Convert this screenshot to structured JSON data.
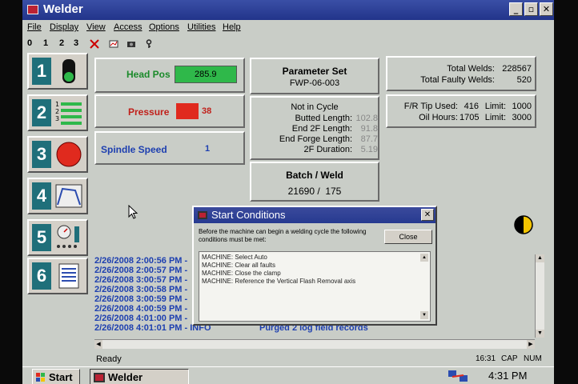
{
  "window": {
    "title": "Welder"
  },
  "menu": [
    "File",
    "Display",
    "View",
    "Access",
    "Options",
    "Utilities",
    "Help"
  ],
  "toolbar": {
    "levels": [
      "0",
      "1",
      "2",
      "3"
    ]
  },
  "function_buttons": [
    "1",
    "2",
    "3",
    "4",
    "5",
    "6"
  ],
  "head_pos": {
    "label": "Head Pos",
    "value": "285.9"
  },
  "pressure": {
    "label": "Pressure",
    "value": "38"
  },
  "spindle": {
    "label": "Spindle Speed",
    "value": "1"
  },
  "parameter_set": {
    "label": "Parameter Set",
    "value": "FWP-06-003"
  },
  "cycle": {
    "status": "Not in Cycle",
    "rows": [
      {
        "label": "Butted Length:",
        "value": "102.8"
      },
      {
        "label": "End 2F Length:",
        "value": "91.8"
      },
      {
        "label": "End Forge Length:",
        "value": "87.7"
      },
      {
        "label": "2F Duration:",
        "value": "5.19"
      }
    ]
  },
  "batch": {
    "label": "Batch / Weld",
    "value": "21690 /  175"
  },
  "welds": {
    "total_label": "Total Welds:",
    "total_value": "228567",
    "faulty_label": "Total Faulty Welds:",
    "faulty_value": "520"
  },
  "tips": {
    "tip_label": "F/R Tip Used:",
    "tip_value": "416",
    "tip_limit_label": "Limit:",
    "tip_limit": "1000",
    "oil_label": "Oil Hours:",
    "oil_value": "1705",
    "oil_limit_label": "Limit:",
    "oil_limit": "3000"
  },
  "log": [
    "2/26/2008 2:00:56 PM -",
    "2/26/2008 2:00:57 PM -",
    "2/26/2008 3:00:57 PM -",
    "2/26/2008 3:00:58 PM -",
    "2/26/2008 3:00:59 PM -",
    "2/26/2008 4:00:59 PM -",
    "2/26/2008 4:01:00 PM -",
    "2/26/2008 4:01:01 PM - INFO"
  ],
  "log_last_message": "Purged 2 log field records",
  "dialog": {
    "title": "Start Conditions",
    "text": "Before the machine can begin a welding cycle the following conditions must be met:",
    "close_label": "Close",
    "items": [
      "MACHINE: Select Auto",
      "MACHINE: Clear all faults",
      "MACHINE: Close the clamp",
      "MACHINE: Reference the Vertical Flash Removal axis"
    ]
  },
  "status": {
    "text": "Ready",
    "time": "16:31",
    "cap": "CAP",
    "num": "NUM"
  },
  "taskbar": {
    "start_label": "Start",
    "app_label": "Welder",
    "clock": "4:31 PM"
  },
  "colors": {
    "accent": "#22348a",
    "teal": "#1f6f7a",
    "green": "#2fb84a",
    "red": "#e02a1e",
    "log_blue": "#1d3fb0"
  }
}
